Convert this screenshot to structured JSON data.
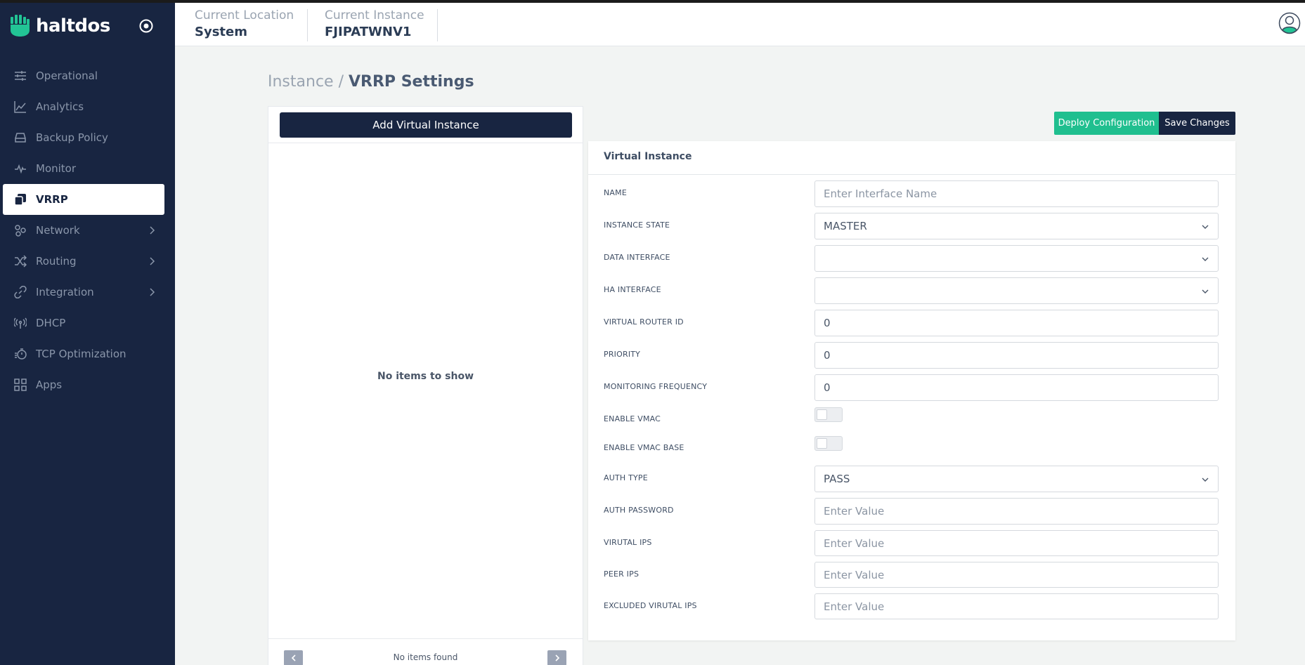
{
  "brand": {
    "name": "haltdos"
  },
  "sidebar": {
    "items": [
      {
        "label": "Operational",
        "icon": "sliders-icon"
      },
      {
        "label": "Analytics",
        "icon": "line-chart-icon"
      },
      {
        "label": "Backup Policy",
        "icon": "drive-icon"
      },
      {
        "label": "Monitor",
        "icon": "pulse-icon"
      },
      {
        "label": "VRRP",
        "icon": "copy-icon",
        "active": true
      },
      {
        "label": "Network",
        "icon": "network-icon",
        "expandable": true
      },
      {
        "label": "Routing",
        "icon": "shuffle-icon",
        "expandable": true
      },
      {
        "label": "Integration",
        "icon": "link-icon",
        "expandable": true
      },
      {
        "label": "DHCP",
        "icon": "broadcast-icon"
      },
      {
        "label": "TCP Optimization",
        "icon": "stopwatch-icon"
      },
      {
        "label": "Apps",
        "icon": "grid-icon"
      }
    ]
  },
  "header": {
    "location_label": "Current Location",
    "location_value": "System",
    "instance_label": "Current Instance",
    "instance_value": "FJIPATWNV1"
  },
  "breadcrumb": {
    "parent": "Instance",
    "separator": "/",
    "current": "VRRP Settings"
  },
  "left_panel": {
    "add_button": "Add Virtual Instance",
    "empty_text": "No items to show",
    "footer_text": "No items found"
  },
  "actions": {
    "deploy": "Deploy Configuration",
    "save": "Save Changes"
  },
  "form": {
    "title": "Virtual Instance",
    "name_label": "NAME",
    "name_placeholder": "Enter Interface Name",
    "instance_state_label": "INSTANCE STATE",
    "instance_state_value": "MASTER",
    "data_interface_label": "DATA INTERFACE",
    "data_interface_value": "",
    "ha_interface_label": "HA INTERFACE",
    "ha_interface_value": "",
    "router_id_label": "VIRTUAL ROUTER ID",
    "router_id_value": "0",
    "priority_label": "PRIORITY",
    "priority_value": "0",
    "monitoring_label": "MONITORING FREQUENCY",
    "monitoring_value": "0",
    "vmac_label": "ENABLE VMAC",
    "vmac_enabled": false,
    "vmac_base_label": "ENABLE VMAC BASE",
    "vmac_base_enabled": false,
    "auth_type_label": "AUTH TYPE",
    "auth_type_value": "PASS",
    "auth_password_label": "AUTH PASSWORD",
    "auth_password_placeholder": "Enter Value",
    "virtual_ips_label": "VIRUTAL IPS",
    "virtual_ips_placeholder": "Enter Value",
    "peer_ips_label": "PEER IPS",
    "peer_ips_placeholder": "Enter Value",
    "excluded_ips_label": "EXCLUDED VIRUTAL IPS",
    "excluded_ips_placeholder": "Enter Value"
  },
  "colors": {
    "sidebar_bg": "#182541",
    "accent": "#20bf8f",
    "page_bg": "#f2f4f3"
  }
}
